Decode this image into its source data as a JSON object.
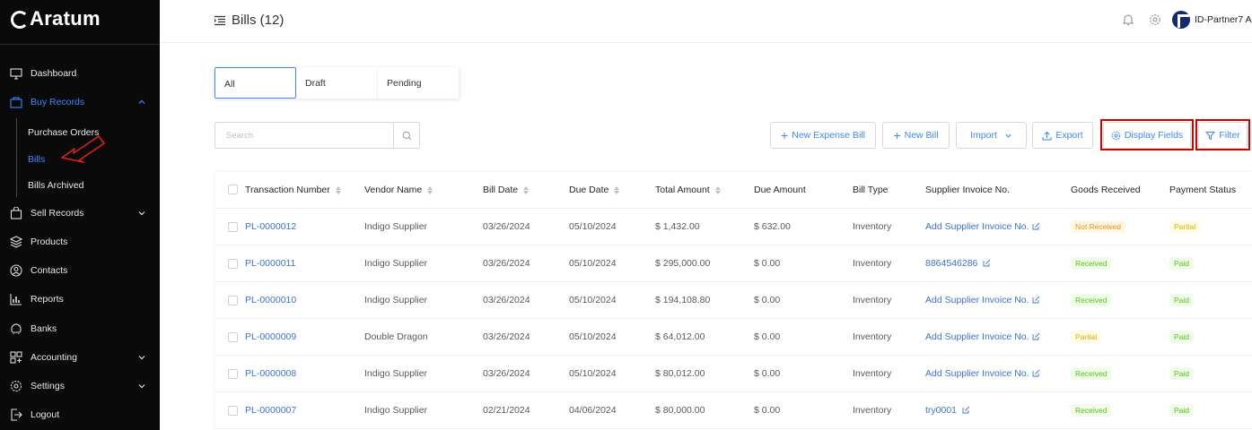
{
  "brand": {
    "name": "Aratum"
  },
  "sidebar": {
    "items": [
      {
        "label": "Dashboard",
        "icon": "monitor-icon"
      },
      {
        "label": "Buy Records",
        "icon": "cart-icon"
      },
      {
        "label": "Sell Records",
        "icon": "bag-icon"
      },
      {
        "label": "Products",
        "icon": "layers-icon"
      },
      {
        "label": "Contacts",
        "icon": "contacts-icon"
      },
      {
        "label": "Reports",
        "icon": "chart-icon"
      },
      {
        "label": "Banks",
        "icon": "bank-icon"
      },
      {
        "label": "Accounting",
        "icon": "accounting-icon"
      },
      {
        "label": "Settings",
        "icon": "gear-icon"
      },
      {
        "label": "Logout",
        "icon": "logout-icon"
      }
    ],
    "sub_items": [
      "Purchase Orders",
      "Bills",
      "Bills Archived"
    ]
  },
  "header": {
    "title": "Bills (12)",
    "user_name": "ID-Partner7 A."
  },
  "tabs": [
    "All",
    "Draft",
    "Pending"
  ],
  "search": {
    "placeholder": "Search"
  },
  "actions": {
    "new_expense_bill": "New Expense Bill",
    "new_bill": "New Bill",
    "import": "Import",
    "export": "Export",
    "display_fields": "Display Fields",
    "filter": "Filter"
  },
  "table": {
    "columns": [
      "Transaction Number",
      "Vendor Name",
      "Bill Date",
      "Due Date",
      "Total Amount",
      "Due Amount",
      "Bill Type",
      "Supplier Invoice No.",
      "Goods Received",
      "Payment Status"
    ],
    "rows": [
      {
        "txn": "PL-0000012",
        "vendor": "Indigo Supplier",
        "bill_date": "03/26/2024",
        "due_date": "05/10/2024",
        "total": "$ 1,432.00",
        "due": "$ 632.00",
        "type": "Inventory",
        "invoice": "Add Supplier Invoice No.",
        "goods": "Not Received",
        "payment": "Partial"
      },
      {
        "txn": "PL-0000011",
        "vendor": "Indigo Supplier",
        "bill_date": "03/26/2024",
        "due_date": "05/10/2024",
        "total": "$ 295,000.00",
        "due": "$ 0.00",
        "type": "Inventory",
        "invoice": "8864546286",
        "goods": "Received",
        "payment": "Paid"
      },
      {
        "txn": "PL-0000010",
        "vendor": "Indigo Supplier",
        "bill_date": "03/26/2024",
        "due_date": "05/10/2024",
        "total": "$ 194,108.80",
        "due": "$ 0.00",
        "type": "Inventory",
        "invoice": "Add Supplier Invoice No.",
        "goods": "Received",
        "payment": "Paid"
      },
      {
        "txn": "PL-0000009",
        "vendor": "Double Dragon",
        "bill_date": "03/26/2024",
        "due_date": "05/10/2024",
        "total": "$ 64,012.00",
        "due": "$ 0.00",
        "type": "Inventory",
        "invoice": "Add Supplier Invoice No.",
        "goods": "Partial",
        "payment": "Paid"
      },
      {
        "txn": "PL-0000008",
        "vendor": "Indigo Supplier",
        "bill_date": "03/26/2024",
        "due_date": "05/10/2024",
        "total": "$ 80,012.00",
        "due": "$ 0.00",
        "type": "Inventory",
        "invoice": "Add Supplier Invoice No.",
        "goods": "Received",
        "payment": "Paid"
      },
      {
        "txn": "PL-0000007",
        "vendor": "Indigo Supplier",
        "bill_date": "02/21/2024",
        "due_date": "04/06/2024",
        "total": "$ 80,000.00",
        "due": "$ 0.00",
        "type": "Inventory",
        "invoice": "try0001",
        "goods": "Received",
        "payment": "Paid"
      }
    ]
  },
  "colors": {
    "accent": "#3f86ff",
    "sidebar_bg": "#0a0a0a",
    "highlight": "#d00000"
  }
}
